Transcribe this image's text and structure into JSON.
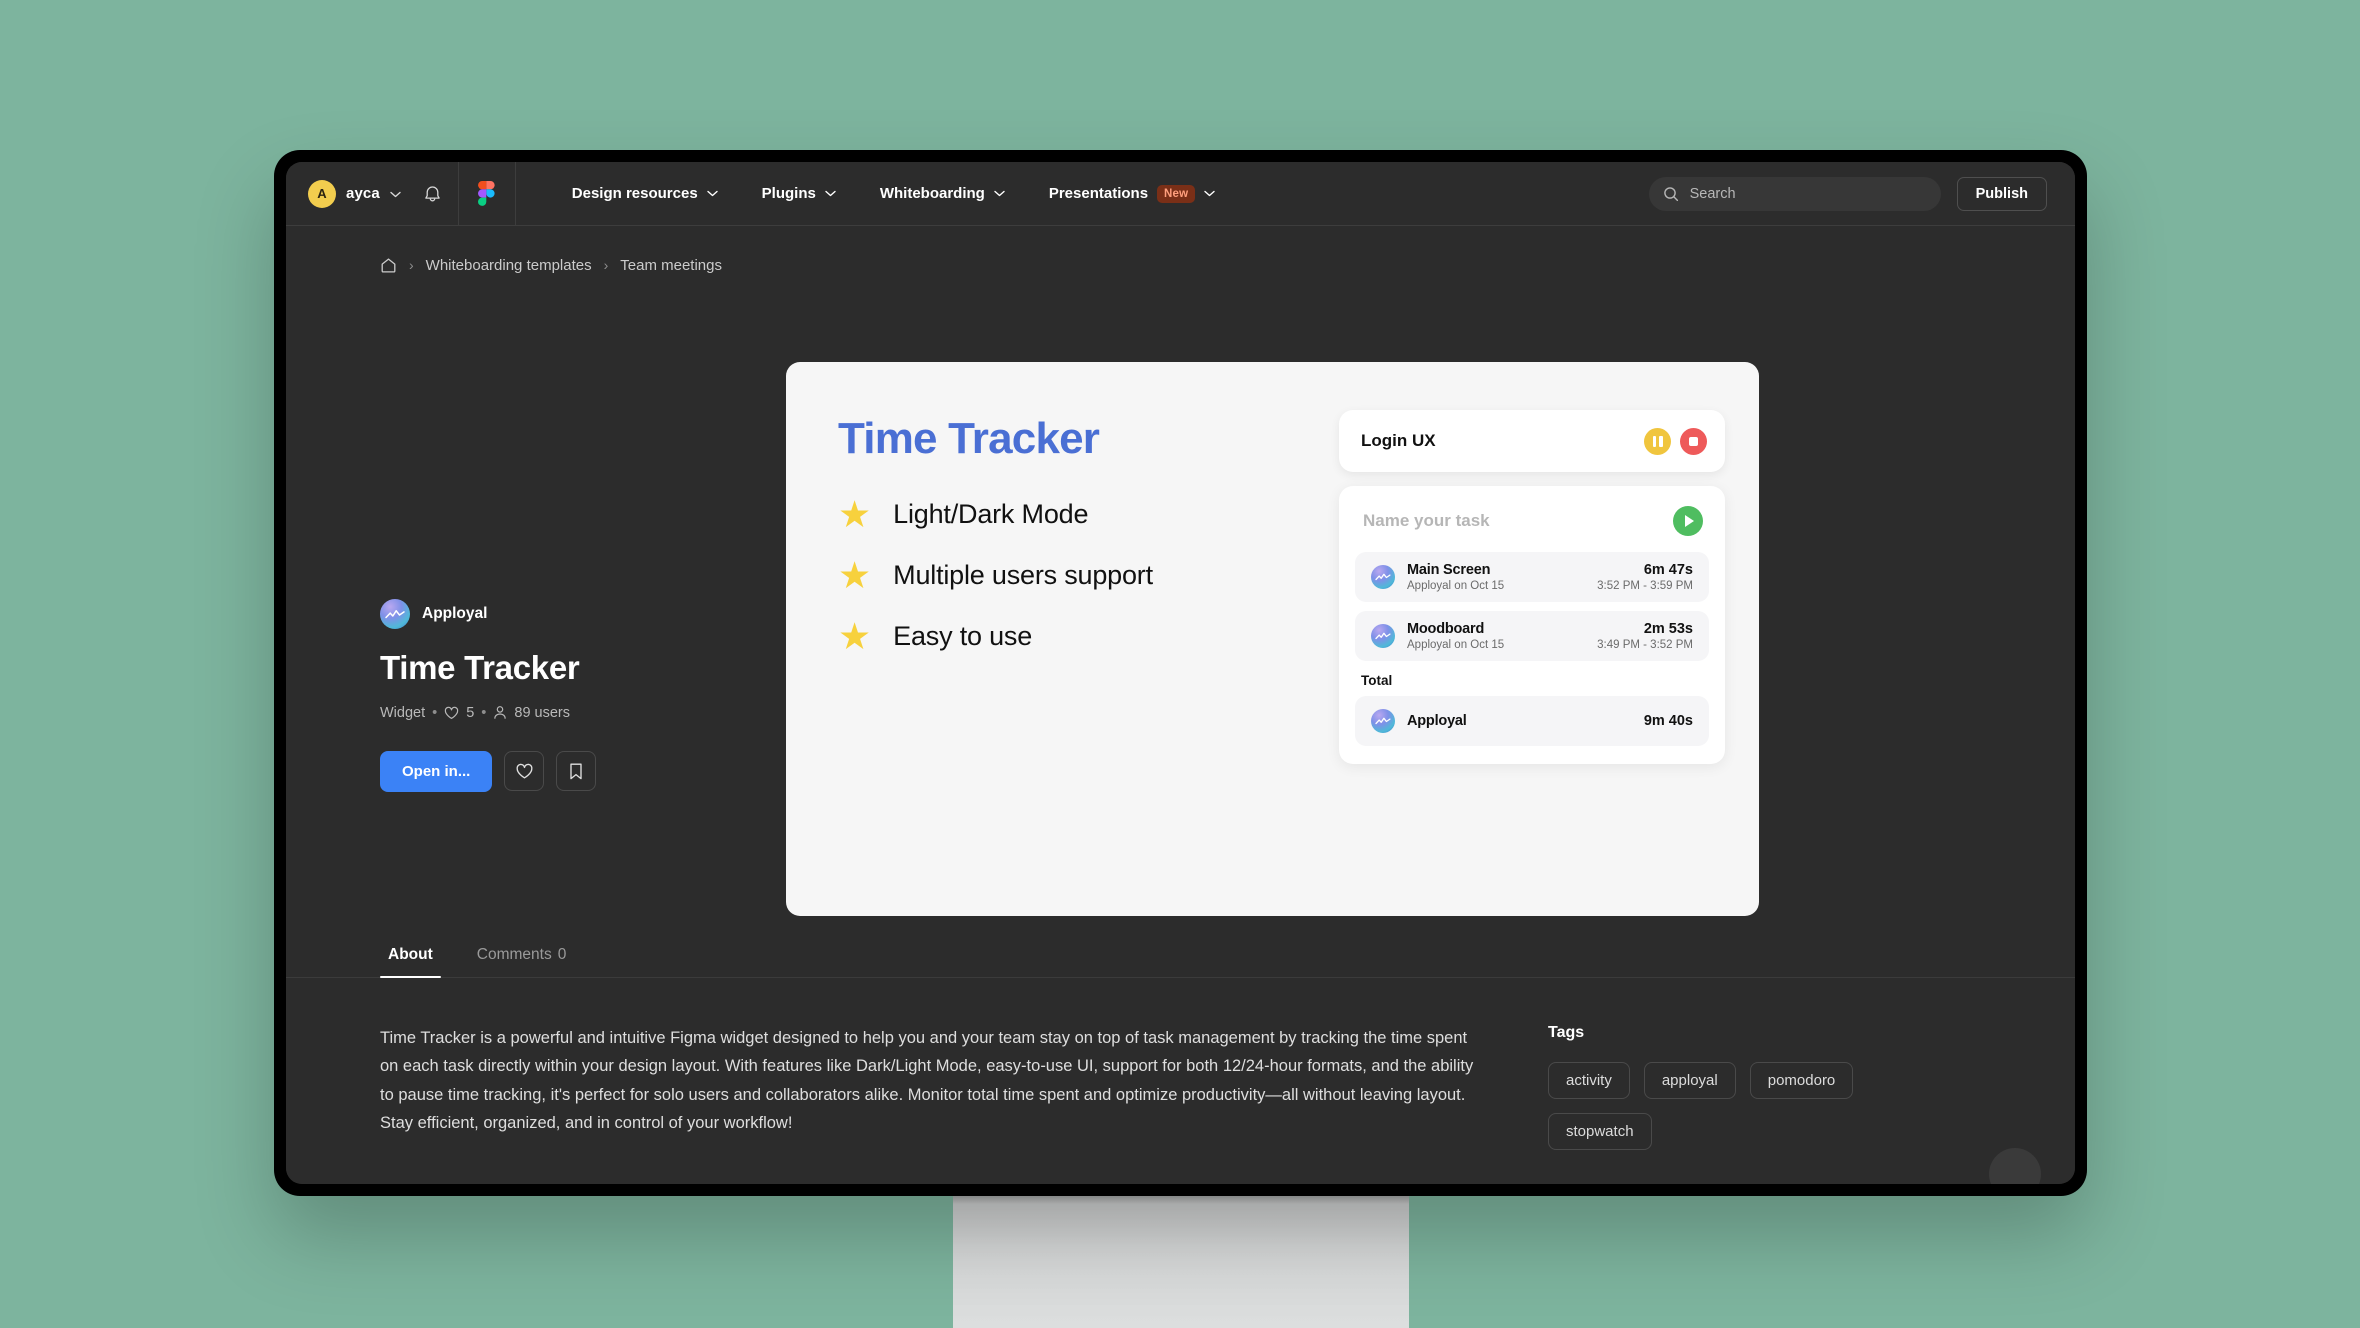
{
  "topnav": {
    "avatar_initial": "A",
    "username": "ayca",
    "bell_icon": "bell-icon",
    "figma_icon": "figma-logo-icon",
    "menu": [
      {
        "label": "Design resources",
        "badge": null
      },
      {
        "label": "Plugins",
        "badge": null
      },
      {
        "label": "Whiteboarding",
        "badge": null
      },
      {
        "label": "Presentations",
        "badge": "New"
      }
    ],
    "search_placeholder": "Search",
    "search_value": "",
    "publish_label": "Publish"
  },
  "breadcrumb": {
    "home_icon": "home-icon",
    "separator": "›",
    "items": [
      "Whiteboarding templates",
      "Team meetings"
    ]
  },
  "hero": {
    "publisher": "Apployal",
    "title": "Time Tracker",
    "meta": {
      "type": "Widget",
      "likes": "5",
      "users": "89 users",
      "dot": "•"
    },
    "open_label": "Open in...",
    "like_icon": "heart-icon",
    "bookmark_icon": "bookmark-icon"
  },
  "preview": {
    "title": "Time Tracker",
    "features": [
      "Light/Dark Mode",
      "Multiple users support",
      "Easy to use"
    ],
    "star_glyph": "★",
    "widget": {
      "active_task": "Login UX",
      "pause_icon": "pause-icon",
      "stop_icon": "stop-icon",
      "play_icon": "play-icon",
      "input_placeholder": "Name your task",
      "entries": [
        {
          "name": "Main Screen",
          "sub": "Apployal on Oct 15",
          "duration": "6m 47s",
          "range": "3:52 PM - 3:59 PM"
        },
        {
          "name": "Moodboard",
          "sub": "Apployal on Oct 15",
          "duration": "2m 53s",
          "range": "3:49 PM - 3:52 PM"
        }
      ],
      "total_label": "Total",
      "total_name": "Apployal",
      "total_duration": "9m 40s"
    }
  },
  "tabs": [
    {
      "label": "About",
      "count": null,
      "active": true
    },
    {
      "label": "Comments",
      "count": "0",
      "active": false
    }
  ],
  "about": {
    "description": "Time Tracker is a powerful and intuitive Figma widget designed to help you and your team stay on top of task management by tracking the time spent on each task directly within your design layout. With features like Dark/Light Mode, easy-to-use UI, support for both 12/24-hour formats, and the ability to pause time tracking, it's perfect for solo users and collaborators alike. Monitor total time spent and optimize productivity—all without leaving layout. Stay efficient, organized, and in control of your workflow!"
  },
  "tags": {
    "title": "Tags",
    "items": [
      "activity",
      "apployal",
      "pomodoro",
      "stopwatch"
    ]
  },
  "colors": {
    "background": "#7db49e",
    "app_bg": "#2c2c2c",
    "accent_blue": "#3b82f6",
    "preview_title_blue": "#4a6fd4",
    "star_yellow": "#f7d13d",
    "avatar_yellow": "#f2cd4e",
    "pause_yellow": "#f0c53e",
    "stop_red": "#ee5a5a",
    "play_green": "#4fbd60",
    "badge_new_bg": "#7a2f17",
    "badge_new_text": "#ff9f7d"
  }
}
